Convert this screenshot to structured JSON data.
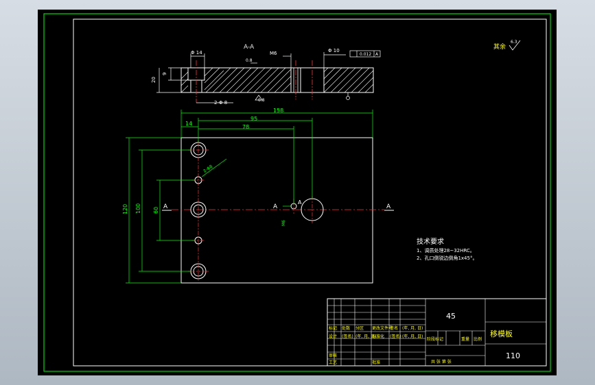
{
  "section_label": "A-A",
  "surface_note": {
    "prefix": "其余",
    "roughness": "6.3"
  },
  "section_dims": {
    "phi14": "Φ 14",
    "depth9": "9",
    "depth20": "20",
    "m6": "M6",
    "phi10": "Φ 10",
    "phi8": "2-Φ 8",
    "tol": "0.012",
    "datum": "A",
    "rough_left": "0.8",
    "rough_mid": "0.8",
    "hole_note": "M6"
  },
  "plan_dims": {
    "w158": "158",
    "d95": "95",
    "d78": "78",
    "d14": "14",
    "h120": "120",
    "h100": "100",
    "h60": "60",
    "hole_small": "2-Φ8",
    "hole_mid": "M6",
    "section_mark_left": "A",
    "section_mark_mid": "A",
    "section_mark_right": "A",
    "section_mark_mid2": "A"
  },
  "tech_req": {
    "title": "技术要求",
    "line1": "1、调质处理28~32HRC。",
    "line2": "2、孔口倒锐边倒角1x45°。"
  },
  "title_block": {
    "material": "45",
    "part_name": "移模板",
    "drawing_no": "110",
    "r1": [
      "标记",
      "处数",
      "分区",
      "更改文件号",
      "签名",
      "(年, 月, 日)"
    ],
    "r2": [
      "设计",
      "(签名)",
      "(年, 月, 日)",
      "标准化",
      "(签名)",
      "(年, 月, 日)"
    ],
    "r3": [
      "审核",
      "",
      "",
      "",
      "",
      ""
    ],
    "r4": [
      "工艺",
      "",
      "批准",
      "",
      "",
      ""
    ],
    "stage": "阶段标记",
    "weight": "重量",
    "scale": "比例",
    "sheets": "共  张  第  张"
  }
}
